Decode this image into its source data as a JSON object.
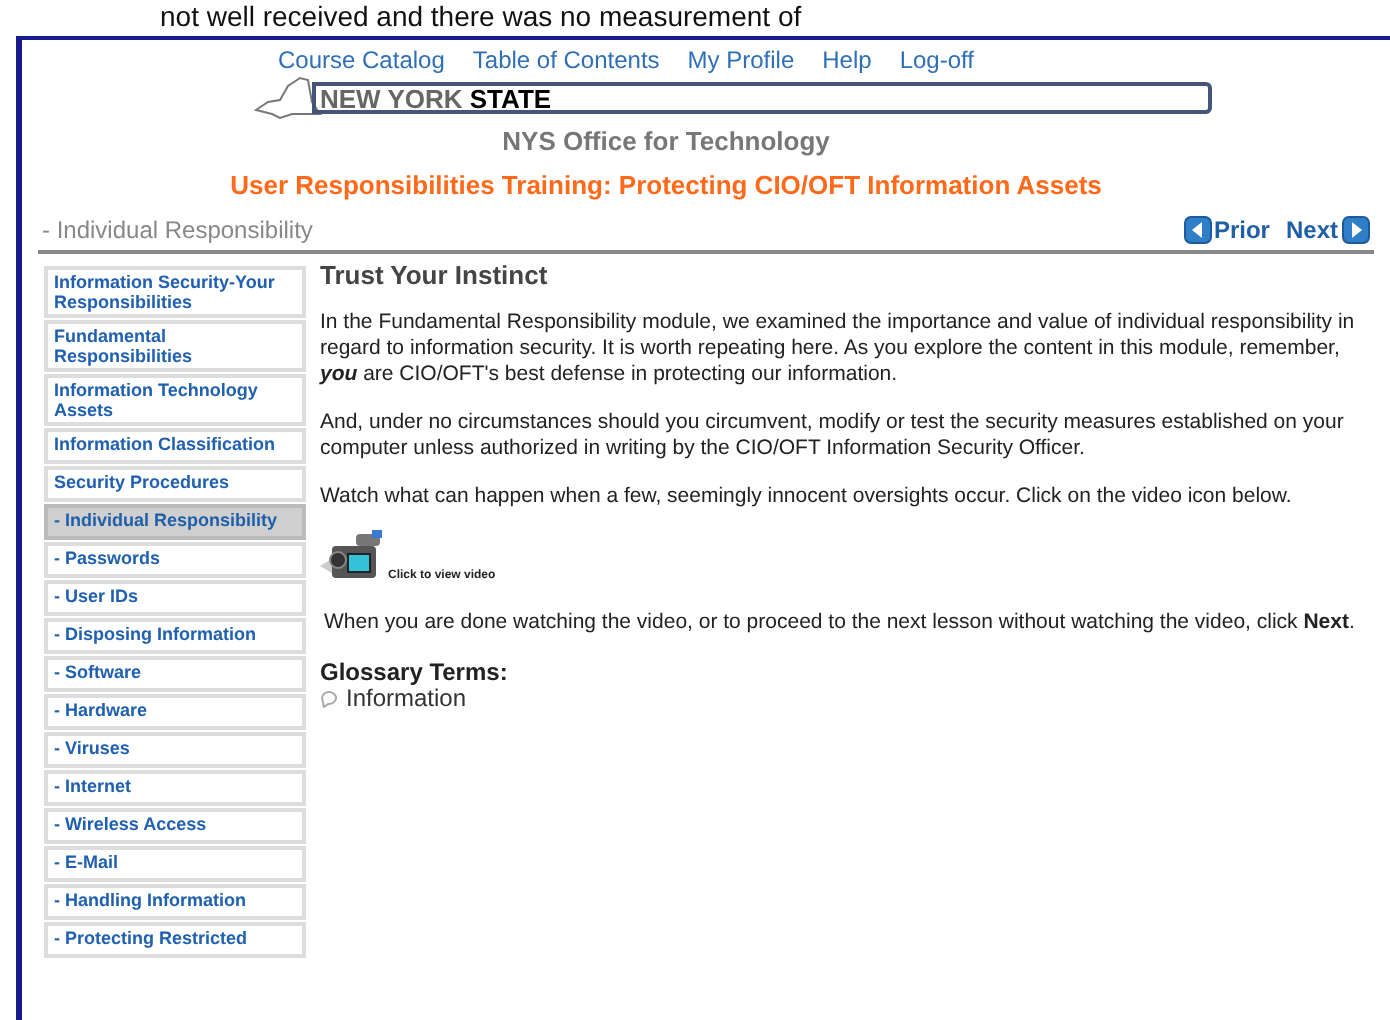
{
  "caption": "not well received and there was no measurement of",
  "top_links": [
    "Course Catalog",
    "Table of Contents",
    "My Profile",
    "Help",
    "Log-off"
  ],
  "logo": {
    "light": "NEW YORK",
    "bold": "STATE"
  },
  "agency": "NYS Office for Technology",
  "course_title": "User Responsibilities Training: Protecting CIO/OFT Information Assets",
  "breadcrumb": "- Individual Responsibility",
  "nav": {
    "prior": "Prior",
    "next": "Next"
  },
  "sidebar": {
    "items": [
      {
        "label": "Information Security-Your Responsibilities",
        "selected": false
      },
      {
        "label": "Fundamental Responsibilities",
        "selected": false
      },
      {
        "label": "Information Technology Assets",
        "selected": false
      },
      {
        "label": "Information Classification",
        "selected": false
      },
      {
        "label": "Security Procedures",
        "selected": false
      },
      {
        "label": "- Individual Responsibility",
        "selected": true
      },
      {
        "label": "- Passwords",
        "selected": false
      },
      {
        "label": "- User IDs",
        "selected": false
      },
      {
        "label": "- Disposing Information",
        "selected": false
      },
      {
        "label": "- Software",
        "selected": false
      },
      {
        "label": "- Hardware",
        "selected": false
      },
      {
        "label": "- Viruses",
        "selected": false
      },
      {
        "label": "- Internet",
        "selected": false
      },
      {
        "label": "- Wireless Access",
        "selected": false
      },
      {
        "label": "- E-Mail",
        "selected": false
      },
      {
        "label": "- Handling Information",
        "selected": false
      },
      {
        "label": "- Protecting Restricted",
        "selected": false
      }
    ]
  },
  "content": {
    "heading": "Trust Your Instinct",
    "paragraphs": [
      "In the Fundamental Responsibility module, we examined the importance and value of individual responsibility in regard to information security. It is worth repeating here. As you explore the content in this module, remember, *you* are CIO/OFT's best defense in protecting our information.",
      "And, under no circumstances should you circumvent, modify or test the security measures established on your computer unless authorized in writing by the CIO/OFT Information Security Officer.",
      "Watch what can happen when a few, seemingly innocent oversights occur. Click on the video icon below."
    ],
    "video_caption": "Click to view video",
    "after_video": "When you are done watching the video, or to proceed to the next lesson without watching the video, click **Next**.",
    "glossary_heading": "Glossary Terms:",
    "glossary_terms": [
      "Information"
    ]
  }
}
